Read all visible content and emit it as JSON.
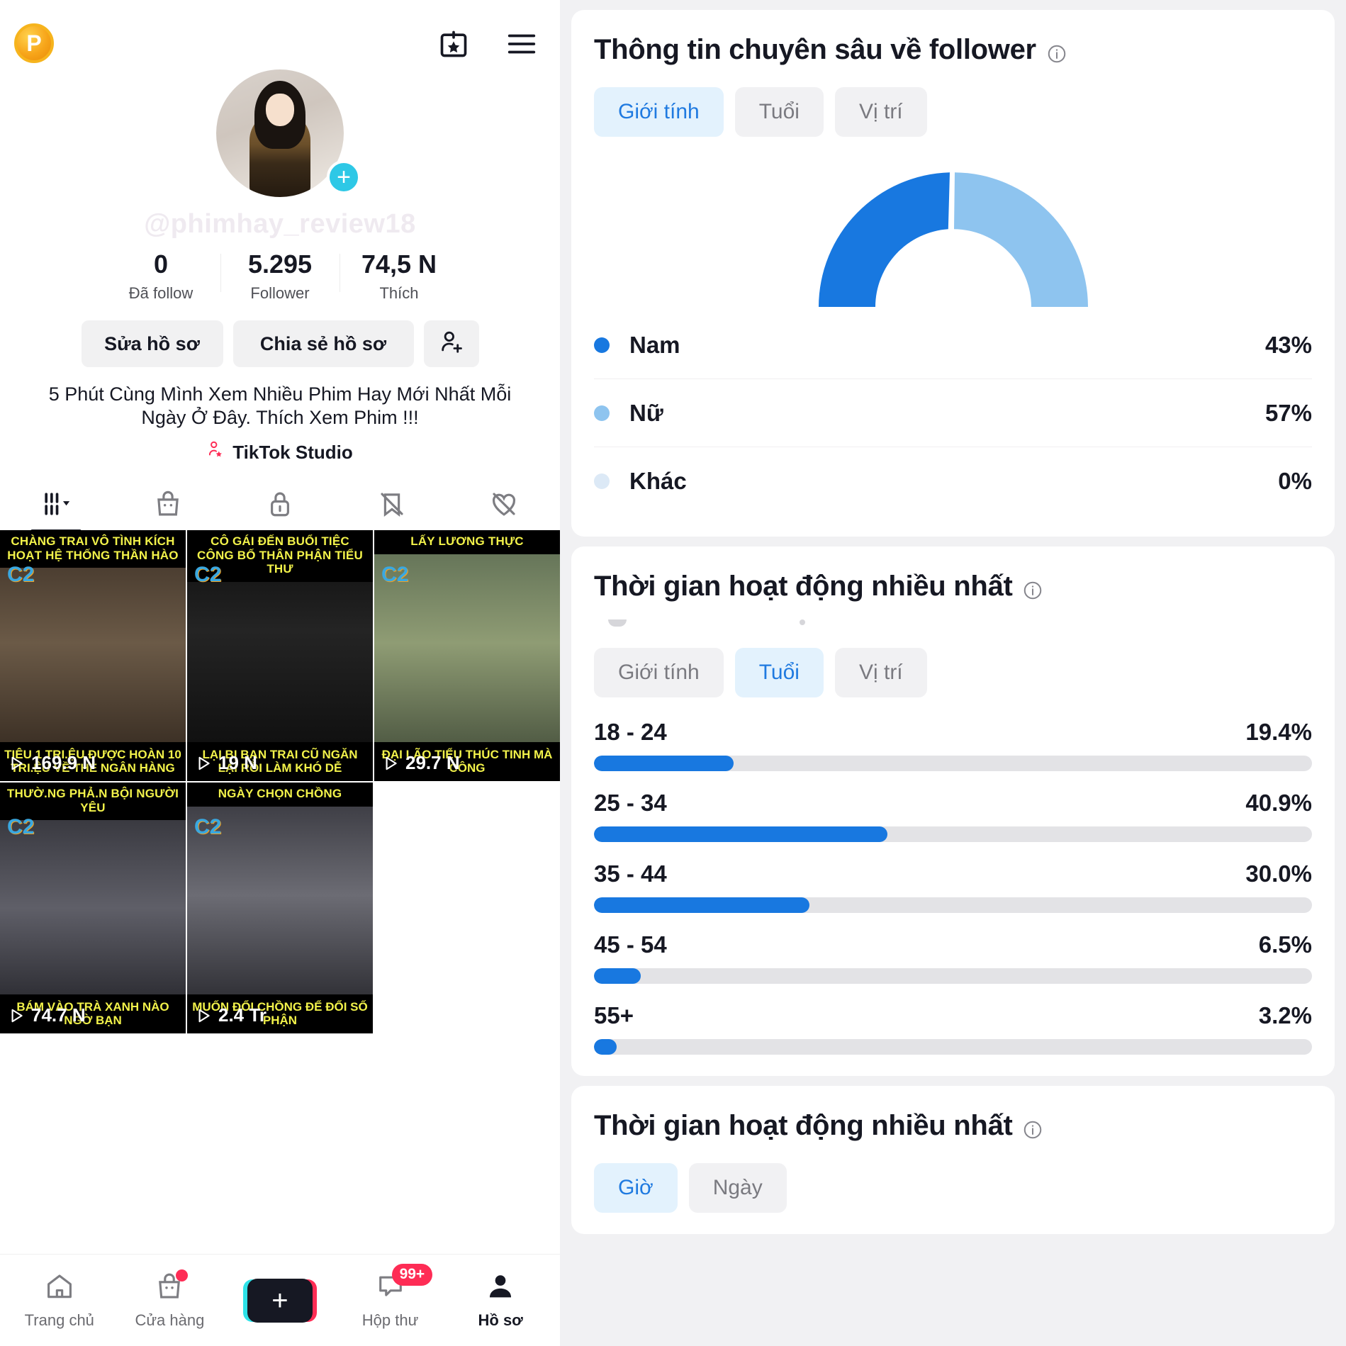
{
  "profile": {
    "coin_badge": "P",
    "handle_watermark": "@phimhay_review18",
    "avatar_plus": "+",
    "stats": [
      {
        "num": "0",
        "label": "Đã follow"
      },
      {
        "num": "5.295",
        "label": "Follower"
      },
      {
        "num": "74,5 N",
        "label": "Thích"
      }
    ],
    "buttons": {
      "edit": "Sửa hồ sơ",
      "share": "Chia sẻ hồ sơ",
      "add_friend_icon": "add-person-icon"
    },
    "bio": "5 Phút Cùng Mình Xem Nhiều Phim Hay Mới Nhất Mỗi Ngày Ở Đây. Thích Xem Phim !!!",
    "studio_label": "TikTok Studio",
    "tabs": [
      {
        "icon": "videos-grid-icon",
        "active": true
      },
      {
        "icon": "shop-bag-icon",
        "active": false
      },
      {
        "icon": "lock-icon",
        "active": false
      },
      {
        "icon": "bookmark-off-icon",
        "active": false
      },
      {
        "icon": "heart-off-icon",
        "active": false
      }
    ],
    "videos": [
      {
        "cap_top": "CHÀNG TRAI VÔ TÌNH KÍCH HOẠT HỆ THỐNG THẦN HÀO",
        "cap_bottom": "TIÊU 1 TRI.ỆU ĐƯỢC HOÀN 10 TRI.ỆU VỀ THẺ NGÂN HÀNG",
        "views": "169.9 N"
      },
      {
        "cap_top": "CÔ GÁI ĐẾN BUỔI TIỆC CÔNG BỐ THÂN PHẬN TIỂU THƯ",
        "cap_bottom": "LẠI BỊ BẠN TRAI CŨ NGĂN LẠI RỒI LÀM KHÓ DỄ",
        "views": "19 N"
      },
      {
        "cap_top": "LẤY LƯƠNG THỰC",
        "cap_bottom": "ĐẠI LÃO TIỂU THÚC TINH MÀ CÔNG",
        "views": "29.7 N"
      },
      {
        "cap_top": "THƯỜ.NG PHẢ.N BỘI NGƯỜI YÊU",
        "cap_bottom": "BÁM VÀO TRÀ XANH NÀO NGỜ BẠN",
        "views": "74.7 N"
      },
      {
        "cap_top": "NGÀY CHỌN CHỒNG",
        "cap_bottom": "MUỐN ĐỔI CHỒNG ĐỂ ĐỔI SỐ PHẬN",
        "views": "2.4 Tr"
      }
    ],
    "bottom_nav": [
      {
        "icon": "home-icon",
        "label": "Trang chủ",
        "active": false,
        "badge": ""
      },
      {
        "icon": "shop-icon",
        "label": "Cửa hàng",
        "active": false,
        "badge": "dot"
      },
      {
        "icon": "create-plus-icon",
        "label": "",
        "active": false,
        "badge": ""
      },
      {
        "icon": "inbox-icon",
        "label": "Hộp thư",
        "active": false,
        "badge": "99+"
      },
      {
        "icon": "profile-icon",
        "label": "Hồ sơ",
        "active": true,
        "badge": ""
      }
    ]
  },
  "analytics": {
    "card1": {
      "title": "Thông tin chuyên sâu về follower",
      "info_icon": "info-icon",
      "pills": [
        {
          "label": "Giới tính",
          "selected": true
        },
        {
          "label": "Tuổi",
          "selected": false
        },
        {
          "label": "Vị trí",
          "selected": false
        }
      ],
      "legend": [
        {
          "label": "Nam",
          "value": "43%",
          "color": "#1878e0"
        },
        {
          "label": "Nữ",
          "value": "57%",
          "color": "#8ec4ef"
        },
        {
          "label": "Khác",
          "value": "0%",
          "color": "#dce9f6"
        }
      ]
    },
    "card2": {
      "title": "Thời gian hoạt động nhiều nhất",
      "info_icon": "info-icon",
      "pills": [
        {
          "label": "Giới tính",
          "selected": false
        },
        {
          "label": "Tuổi",
          "selected": true
        },
        {
          "label": "Vị trí",
          "selected": false
        }
      ]
    },
    "card3": {
      "title": "Thời gian hoạt động nhiều nhất",
      "info_icon": "info-icon",
      "pills": [
        {
          "label": "Giờ",
          "selected": true
        },
        {
          "label": "Ngày",
          "selected": false
        }
      ]
    }
  },
  "chart_data": [
    {
      "type": "pie",
      "title": "Thông tin chuyên sâu về follower",
      "subtype": "semi-donut-gauge",
      "labels": [
        "Nam",
        "Nữ",
        "Khác"
      ],
      "values": [
        43,
        57,
        0
      ],
      "value_labels": [
        "43%",
        "57%",
        "0%"
      ],
      "colors": [
        "#1878e0",
        "#8ec4ef",
        "#dce9f6"
      ],
      "legend": "bottom",
      "unit": "%"
    },
    {
      "type": "bar",
      "orientation": "horizontal",
      "title": "Thời gian hoạt động nhiều nhất",
      "categories": [
        "18 - 24",
        "25 - 34",
        "35 - 44",
        "45 - 54",
        "55+"
      ],
      "values": [
        19.4,
        40.9,
        30.0,
        6.5,
        3.2
      ],
      "value_labels": [
        "19.4%",
        "40.9%",
        "30.0%",
        "6.5%",
        "3.2%"
      ],
      "xlabel": "",
      "ylabel": "",
      "xlim": [
        0,
        100
      ],
      "grid": false,
      "bar_color": "#1878e0",
      "track_color": "#e3e3e6",
      "unit": "%"
    }
  ]
}
